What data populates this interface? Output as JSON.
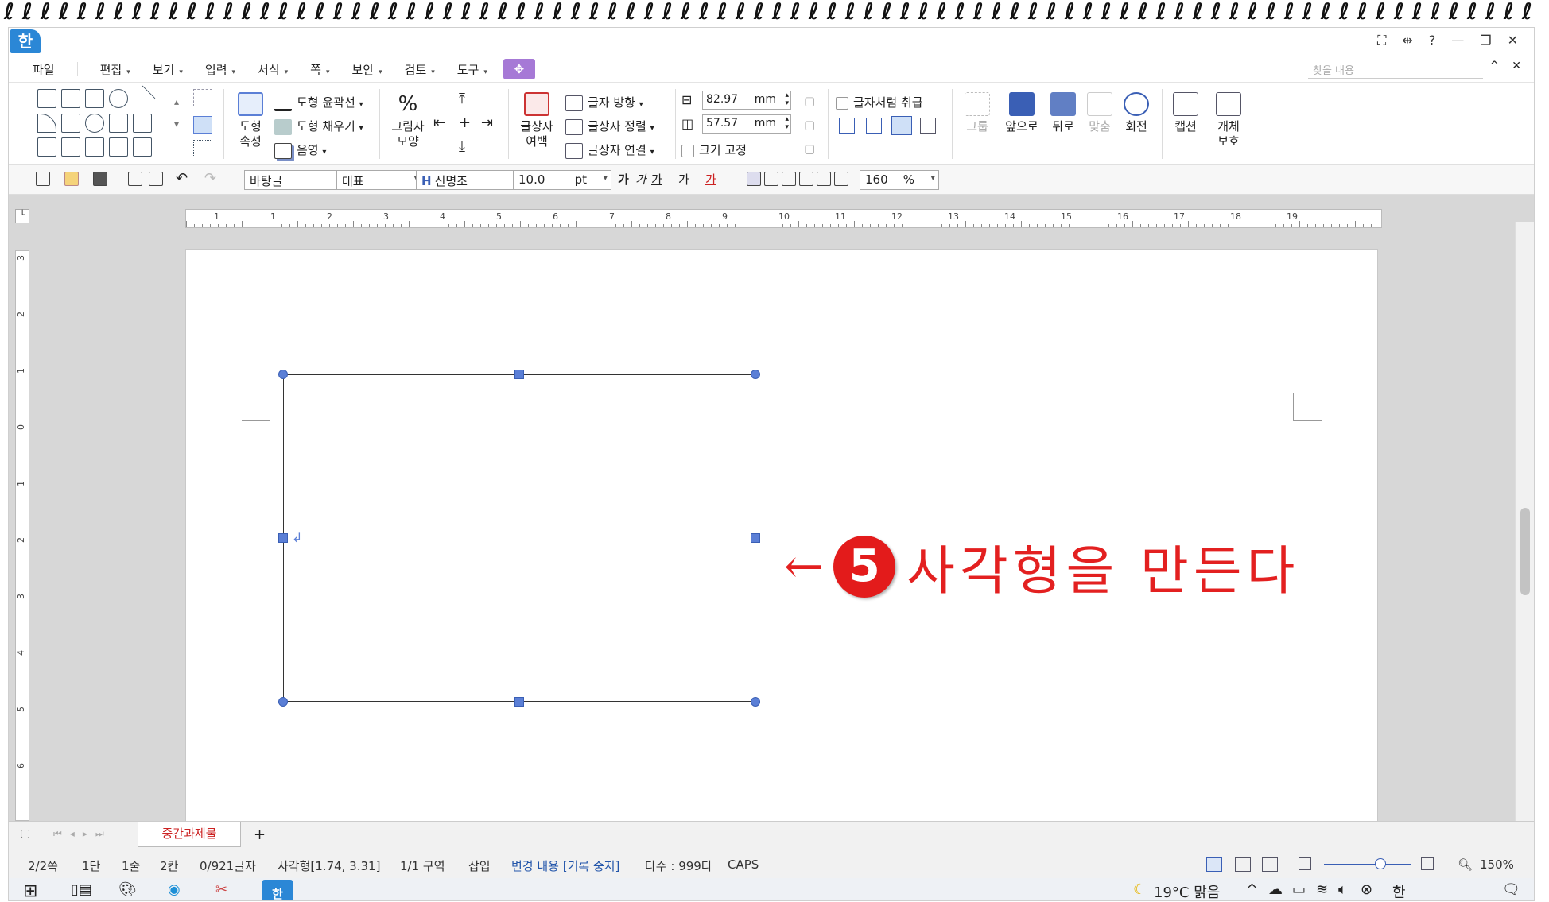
{
  "window": {
    "app_icon": "한",
    "controls": [
      "⛶",
      "⇹",
      "?",
      "—",
      "❐",
      "✕"
    ]
  },
  "menu": {
    "items": [
      "파일",
      "편집",
      "보기",
      "입력",
      "서식",
      "쪽",
      "보안",
      "검토",
      "도구"
    ],
    "search_placeholder": "찾을 내용",
    "right_controls": [
      "^",
      "✕"
    ]
  },
  "ribbon": {
    "shape_props": "도형\n속성",
    "outline": "도형 윤곽선",
    "fill": "도형 채우기",
    "shadow": "음영",
    "picture_shape": "그림자\n모양",
    "textbox_margin": "글상자\n여백",
    "text_dir": "글자 방향",
    "text_align": "글상자 정렬",
    "text_link": "글상자 연결",
    "height_value": "82.97",
    "width_value": "57.57",
    "unit": "mm",
    "size_fix": "크기 고정",
    "as_char": "글자처럼 취급",
    "group": "그룹",
    "front": "앞으로",
    "back": "뒤로",
    "align": "맞춤",
    "rotate": "회전",
    "caption": "캡션",
    "protect": "개체\n보호"
  },
  "toolbar2": {
    "style": "바탕글",
    "lang": "대표",
    "font": "신명조",
    "font_size": "10.0",
    "size_unit": "pt",
    "zoom_line": "160",
    "zoom_unit": "%"
  },
  "ruler": {
    "h_ticks": [
      "1",
      "1",
      "2",
      "3",
      "4",
      "5",
      "6",
      "7",
      "8",
      "9",
      "10",
      "11",
      "12",
      "13",
      "14",
      "15",
      "16",
      "17",
      "18",
      "19"
    ],
    "v_ticks": [
      "3",
      "2",
      "1",
      "0",
      "1",
      "2",
      "3",
      "4",
      "5",
      "6"
    ]
  },
  "annotation": {
    "arrow": "←",
    "number": "5",
    "text": "사각형을 만든다"
  },
  "tabs": {
    "doc_tab": "중간과제물",
    "add": "+"
  },
  "status": {
    "page": "2/2쪽",
    "col": "1단",
    "line": "1줄",
    "char": "2칸",
    "count": "0/921글자",
    "object": "사각형[1.74, 3.31]",
    "section": "1/1 구역",
    "mode": "삽입",
    "track": "변경 내용 [기록 중지]",
    "typing": "타수 : 999타",
    "caps": "CAPS",
    "zoom": "150%"
  },
  "taskbar": {
    "weather": "19°C 맑음",
    "ime": "한"
  }
}
